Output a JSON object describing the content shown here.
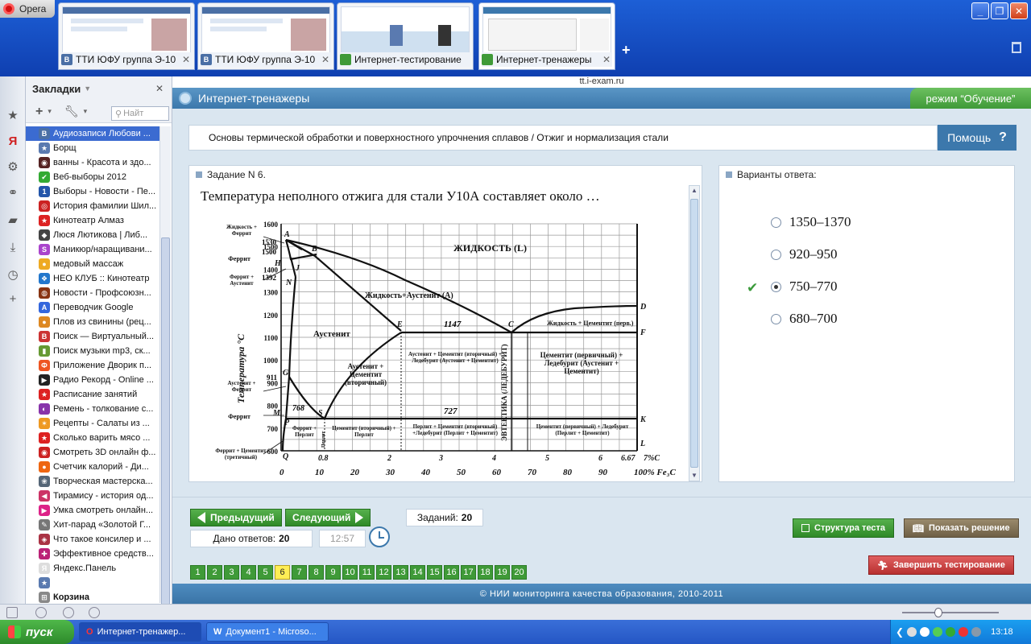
{
  "browser": {
    "menu_label": "Opera",
    "address": "tt.i-exam.ru",
    "tabs": [
      {
        "label": "ТТИ ЮФУ группа Э-10",
        "fav": "В",
        "fav_color": "#4a6fa5"
      },
      {
        "label": "ТТИ ЮФУ группа Э-10",
        "fav": "В",
        "fav_color": "#4a6fa5"
      },
      {
        "label": "Интернет-тестирование",
        "fav": "",
        "fav_color": "#3f9a38"
      },
      {
        "label": "Интернет-тренажеры",
        "fav": "",
        "fav_color": "#3f9a38"
      }
    ]
  },
  "bookmarks": {
    "title": "Закладки",
    "search_placeholder": "Найт",
    "items": [
      {
        "label": "Аудиозаписи Любови ...",
        "fav": "В",
        "color": "#4a6fa5"
      },
      {
        "label": "Борщ",
        "fav": "★",
        "color": "#5a7ab0"
      },
      {
        "label": "ванны - Красота и здо...",
        "fav": "◉",
        "color": "#552222"
      },
      {
        "label": "Веб-выборы 2012",
        "fav": "✔",
        "color": "#33aa33"
      },
      {
        "label": "Выборы - Новости - Пе...",
        "fav": "1",
        "color": "#2255aa"
      },
      {
        "label": "История фамилии Шил...",
        "fav": "◎",
        "color": "#cc2222"
      },
      {
        "label": "Кинотеатр Алмаз",
        "fav": "★",
        "color": "#dd2222"
      },
      {
        "label": "Люся Лютикова | Либ...",
        "fav": "◆",
        "color": "#444444"
      },
      {
        "label": "Маникюр/наращивани...",
        "fav": "S",
        "color": "#aa44cc"
      },
      {
        "label": "медовый массаж",
        "fav": "●",
        "color": "#eeaa22"
      },
      {
        "label": "НЕО КЛУБ :: Кинотеатр",
        "fav": "❖",
        "color": "#2277cc"
      },
      {
        "label": "Новости - Профсоюзн...",
        "fav": "◍",
        "color": "#883311"
      },
      {
        "label": "Переводчик Google",
        "fav": "A",
        "color": "#3366dd"
      },
      {
        "label": "Плов из свинины (рец...",
        "fav": "●",
        "color": "#dd8822"
      },
      {
        "label": "Поиск — Виртуальный...",
        "fav": "B",
        "color": "#cc3333"
      },
      {
        "label": "Поиск музыки mp3, ск...",
        "fav": "▮",
        "color": "#669933"
      },
      {
        "label": "Приложение Дворик п...",
        "fav": "Ф",
        "color": "#ee5522"
      },
      {
        "label": "Радио Рекорд - Online ...",
        "fav": "▶",
        "color": "#222222"
      },
      {
        "label": "Расписание занятий",
        "fav": "★",
        "color": "#dd2222"
      },
      {
        "label": "Ремень - толкование с...",
        "fav": "◐",
        "color": "#8833aa"
      },
      {
        "label": "Рецепты - Салаты из ...",
        "fav": "✶",
        "color": "#ee9922"
      },
      {
        "label": "Сколько варить мясо ...",
        "fav": "★",
        "color": "#dd2222"
      },
      {
        "label": "Смотреть 3D онлайн ф...",
        "fav": "◉",
        "color": "#cc2222"
      },
      {
        "label": "Счетчик калорий - Ди...",
        "fav": "●",
        "color": "#ee6611"
      },
      {
        "label": "Творческая мастерска...",
        "fav": "❀",
        "color": "#556677"
      },
      {
        "label": "Тирамису - история од...",
        "fav": "◀",
        "color": "#cc3366"
      },
      {
        "label": "Умка смотреть онлайн...",
        "fav": "▶",
        "color": "#dd2288"
      },
      {
        "label": "Хит-парад «Золотой Г...",
        "fav": "✎",
        "color": "#777777"
      },
      {
        "label": "Что такое консилер и ...",
        "fav": "◈",
        "color": "#aa3344"
      },
      {
        "label": "Эффективное средств...",
        "fav": "✚",
        "color": "#bb2277"
      },
      {
        "label": "Яндекс.Панель",
        "fav": "Я",
        "color": "#dddddd"
      },
      {
        "label": "",
        "fav": "★",
        "color": "#5a7ab0"
      },
      {
        "label": "Корзина",
        "fav": "⊞",
        "color": "#888888"
      }
    ]
  },
  "site": {
    "title": "Интернет-тренажеры",
    "mode": "режим “Обучение”",
    "subject": "Основы термической обработки и поверхностного упрочнения сплавов / Отжиг и нормализация стали",
    "help_label": "Помощь",
    "task_header": "Задание N 6.",
    "task_title": "Температура неполного отжига для стали У10А составляет около …",
    "answers_header": "Варианты ответа:",
    "answers": [
      {
        "label": "1350–1370",
        "selected": false
      },
      {
        "label": "920–950",
        "selected": false
      },
      {
        "label": "750–770",
        "selected": true
      },
      {
        "label": "680–700",
        "selected": false
      }
    ],
    "prev_label": "Предыдущий",
    "next_label": "Следующий",
    "tasks_label": "Заданий:",
    "tasks_count": "20",
    "answered_label": "Дано ответов:",
    "answered_count": "20",
    "timer": "12:57",
    "structure_label": "Структура теста",
    "solution_label": "Показать решение",
    "finish_label": "Завершить тестирование",
    "pages": [
      "1",
      "2",
      "3",
      "4",
      "5",
      "6",
      "7",
      "8",
      "9",
      "10",
      "11",
      "12",
      "13",
      "14",
      "15",
      "16",
      "17",
      "18",
      "19",
      "20"
    ],
    "current_page": "6",
    "footer": "© НИИ мониторинга качества образования, 2010-2011"
  },
  "diagram": {
    "y_axis_title": "Температура °C",
    "y_ticks": [
      "1600",
      "1500",
      "1400",
      "1300",
      "1200",
      "1100",
      "1000",
      "900",
      "800",
      "700",
      "600"
    ],
    "x_ticks_top": [
      "0.8",
      "2",
      "3",
      "4",
      "5",
      "6",
      "6.67",
      "7%C"
    ],
    "x_ticks_bottom": [
      "0",
      "10",
      "20",
      "30",
      "40",
      "50",
      "60",
      "70",
      "80",
      "90",
      "100% Fe₃C"
    ],
    "special_temps": [
      "1530",
      "1500",
      "1392",
      "911",
      "768",
      "1147",
      "727"
    ],
    "points": [
      "A",
      "B",
      "H",
      "J",
      "N",
      "E",
      "C",
      "D",
      "F",
      "G",
      "S",
      "P",
      "Q",
      "K",
      "L",
      "M"
    ],
    "regions": {
      "liquid": "ЖИДКОСТЬ (L)",
      "liquid_austenite": "Жидкость+Аустенит (А)",
      "liquid_cementite": "Жидкость + Цементит (перв.)",
      "austenite": "Аустенит",
      "austenite_cementite": "Аустенит + Цементит (вторичный)",
      "austenite_cementite_ledeburite": "Аустенит + Цементит (вторичный) + Ледебурит (Аустенит + Цементит)",
      "cementite_ledeburite": "Цементит (первичный) + Ледебурит (Аустенит + Цементит)",
      "eutectic": "ЭВТЕКТИКА (ЛЕДЕБУРИТ)",
      "ferrite_pearlite": "Феррит + Перлит",
      "pearlite": "Перлит",
      "cementite_pearlite": "Цементит (вторичный) + Перлит",
      "pearlite_cementite_ledeburite": "Перлит + Цементит (вторичный) +Ледебурит (Перлит + Цементит)",
      "cementite_ledeburite_low": "Цементит (первичный) + Ледебурит (Перлит + Цементит)"
    },
    "left_labels": [
      "Жидкость + Феррит",
      "Феррит",
      "Феррит + Аустенит",
      "Аустенит + Феррит",
      "Феррит",
      "Феррит + Цементит (третичный)"
    ]
  },
  "taskbar": {
    "start_label": "пуск",
    "tasks": [
      "Интернет-тренажер...",
      "Документ1 - Microso..."
    ],
    "clock": "13:18"
  }
}
